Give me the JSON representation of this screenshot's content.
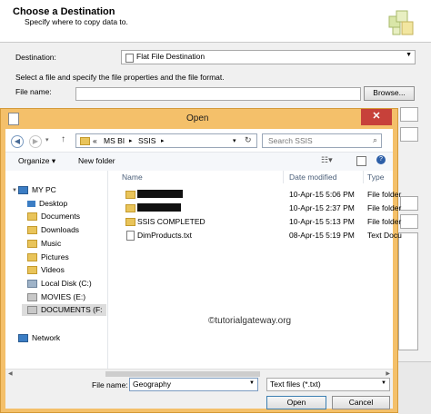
{
  "wizard": {
    "title": "Choose a Destination",
    "subtitle": "Specify where to copy data to.",
    "destination_label": "Destination:",
    "destination_value": "Flat File Destination",
    "instructions": "Select a file and specify the file properties and the file format.",
    "file_name_label": "File name:",
    "file_name_value": "",
    "browse_label": "Browse..."
  },
  "dialog": {
    "title": "Open",
    "close_glyph": "✕",
    "breadcrumb": [
      "«",
      "MS BI",
      "SSIS"
    ],
    "search_placeholder": "Search SSIS",
    "toolbar": {
      "organize_label": "Organize ▾",
      "new_folder_label": "New folder"
    },
    "nav": [
      {
        "label": "MY PC",
        "icon": "computer-icon"
      },
      {
        "label": "Desktop",
        "icon": "desktop-icon"
      },
      {
        "label": "Documents",
        "icon": "documents-icon"
      },
      {
        "label": "Downloads",
        "icon": "downloads-icon"
      },
      {
        "label": "Music",
        "icon": "music-icon"
      },
      {
        "label": "Pictures",
        "icon": "pictures-icon"
      },
      {
        "label": "Videos",
        "icon": "videos-icon"
      },
      {
        "label": "Local Disk (C:)",
        "icon": "drive-icon"
      },
      {
        "label": "MOVIES (E:)",
        "icon": "drive-icon"
      },
      {
        "label": "DOCUMENTS (F:",
        "icon": "drive-icon"
      },
      {
        "label": "Network",
        "icon": "network-icon"
      }
    ],
    "columns": {
      "name": "Name",
      "date": "Date modified",
      "type": "Type"
    },
    "files": [
      {
        "name": "",
        "date": "10-Apr-15 5:06 PM",
        "type": "File folder",
        "icon": "folder-icon",
        "redacted": true
      },
      {
        "name": "",
        "date": "10-Apr-15 2:37 PM",
        "type": "File folder",
        "icon": "folder-icon",
        "redacted": true
      },
      {
        "name": "SSIS COMPLETED",
        "date": "10-Apr-15 5:13 PM",
        "type": "File folder",
        "icon": "folder-icon",
        "redacted": false
      },
      {
        "name": "DimProducts.txt",
        "date": "08-Apr-15 5:19 PM",
        "type": "Text Docu",
        "icon": "text-file-icon",
        "redacted": false
      }
    ],
    "watermark": "©tutorialgateway.org",
    "file_name_label": "File name:",
    "file_name_value": "Geography",
    "file_type_value": "Text files (*.txt)",
    "open_label": "Open",
    "cancel_label": "Cancel"
  }
}
